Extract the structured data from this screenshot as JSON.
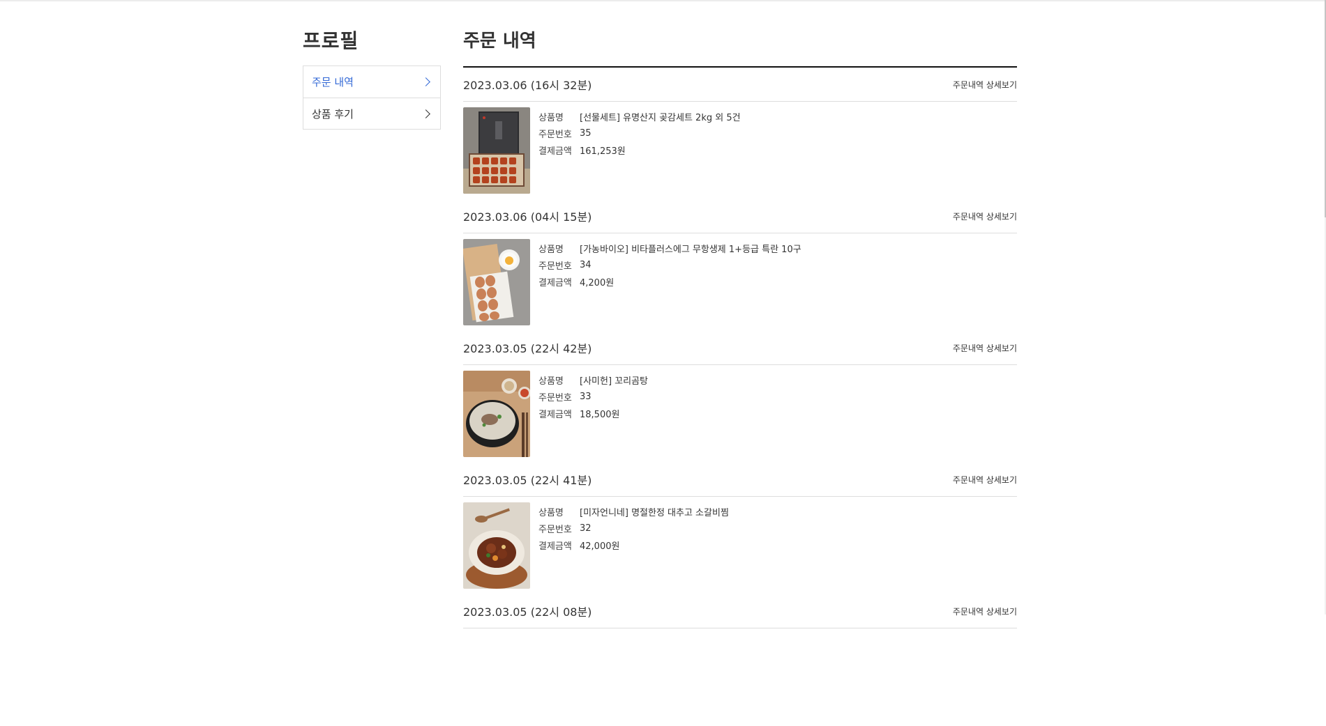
{
  "sidebar": {
    "title": "프로필",
    "items": [
      {
        "label": "주문 내역",
        "active": true
      },
      {
        "label": "상품 후기",
        "active": false
      }
    ]
  },
  "main": {
    "title": "주문 내역",
    "detail_link_label": "주문내역 상세보기",
    "labels": {
      "product": "상품명",
      "order_no": "주문번호",
      "amount": "결제금액"
    },
    "orders": [
      {
        "date": "2023.03.06 (16시 32분)",
        "product": "[선물세트] 유명산지 곶감세트 2kg 외 5건",
        "order_no": "35",
        "amount": "161,253원",
        "image": "persimmon-gift-box"
      },
      {
        "date": "2023.03.06 (04시 15분)",
        "product": "[가농바이오] 비타플러스에그 무항생제 1+등급 특란 10구",
        "order_no": "34",
        "amount": "4,200원",
        "image": "eggs-tray"
      },
      {
        "date": "2023.03.05 (22시 42분)",
        "product": "[사미헌] 꼬리곰탕",
        "order_no": "33",
        "amount": "18,500원",
        "image": "oxtail-soup"
      },
      {
        "date": "2023.03.05 (22시 41분)",
        "product": "[미자언니네] 명절한정 대추고 소갈비찜",
        "order_no": "32",
        "amount": "42,000원",
        "image": "braised-short-ribs"
      },
      {
        "date": "2023.03.05 (22시 08분)"
      }
    ]
  },
  "colors": {
    "accent": "#3369d6",
    "rule": "#111111",
    "divider": "#dddddd",
    "text": "#333333"
  }
}
